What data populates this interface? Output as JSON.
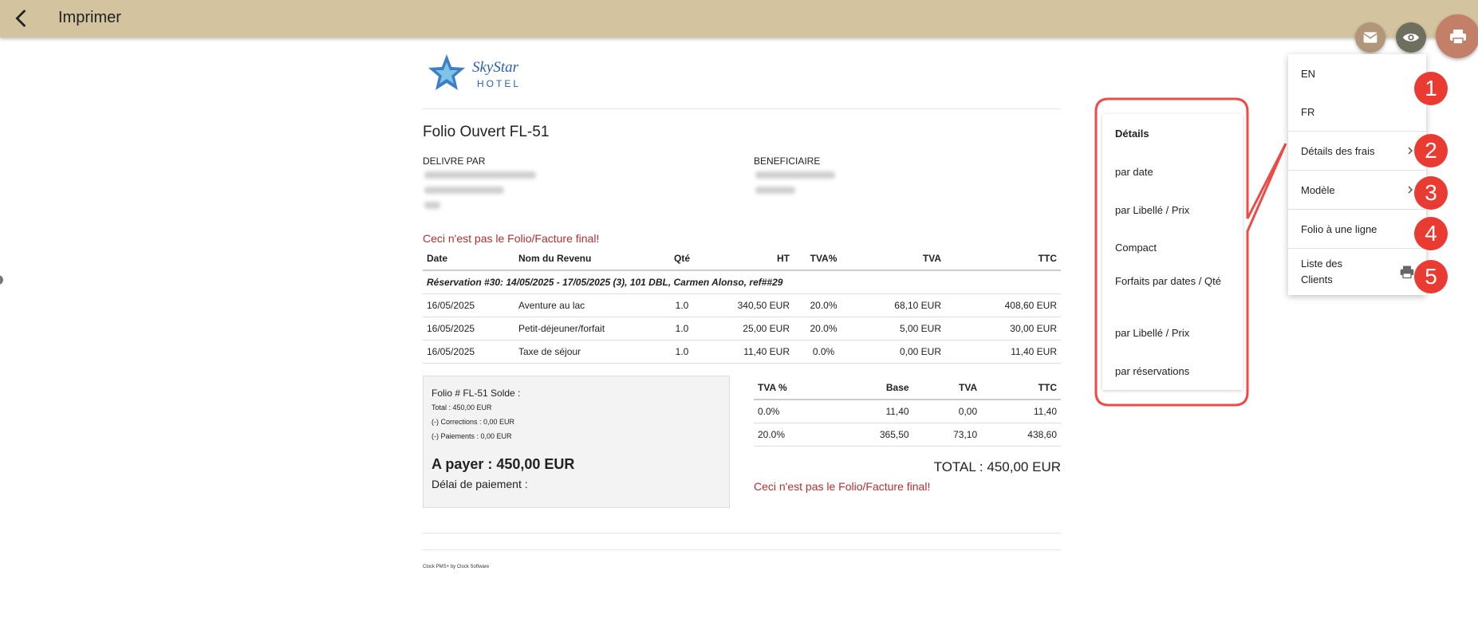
{
  "appbar": {
    "title": "Imprimer"
  },
  "fabs": {
    "mail": "mail-icon",
    "view": "eye-icon",
    "print": "print-icon"
  },
  "document": {
    "logo_brand": "SkyStar",
    "logo_sub": "HOTEL",
    "folio_title": "Folio Ouvert FL-51",
    "issuer_label": "DELIVRE PAR",
    "beneficiary_label": "BENEFICIAIRE",
    "warning": "Ceci n'est pas le Folio/Facture final!",
    "table": {
      "headers": [
        "Date",
        "Nom du Revenu",
        "Qté",
        "HT",
        "TVA%",
        "TVA",
        "TTC"
      ],
      "reservation": "Réservation #30: 14/05/2025 - 17/05/2025 (3), 101 DBL, Carmen Alonso, ref##29",
      "rows": [
        [
          "16/05/2025",
          "Aventure au lac",
          "1.0",
          "340,50 EUR",
          "20.0%",
          "68,10 EUR",
          "408,60 EUR"
        ],
        [
          "16/05/2025",
          "Petit-déjeuner/forfait",
          "1.0",
          "25,00 EUR",
          "20.0%",
          "5,00 EUR",
          "30,00 EUR"
        ],
        [
          "16/05/2025",
          "Taxe de séjour",
          "1.0",
          "11,40 EUR",
          "0.0%",
          "0,00 EUR",
          "11,40 EUR"
        ]
      ]
    },
    "solde": {
      "title": "Folio # FL-51 Solde :",
      "total": "Total : 450,00 EUR",
      "corrections": "(-) Corrections : 0,00 EUR",
      "payments": "(-) Paiements : 0,00 EUR",
      "to_pay": "A payer : 450,00 EUR",
      "delay": "Délai de paiement :"
    },
    "vat_table": {
      "headers": [
        "TVA %",
        "Base",
        "TVA",
        "TTC"
      ],
      "rows": [
        [
          "0.0%",
          "11,40",
          "0,00",
          "11,40"
        ],
        [
          "20.0%",
          "365,50",
          "73,10",
          "438,60"
        ]
      ]
    },
    "total": "TOTAL : 450,00 EUR",
    "footer": "Clock PMS+ by Clock Software"
  },
  "menu": {
    "items": [
      {
        "label": "EN"
      },
      {
        "label": "FR"
      },
      {
        "label": "Détails des frais"
      },
      {
        "label": "Modèle"
      },
      {
        "label": "Folio à une ligne"
      },
      {
        "label": "Liste des Clients"
      }
    ]
  },
  "submenu": {
    "items": [
      "Détails",
      "par date",
      "par Libellé / Prix",
      "Compact",
      "Forfaits par dates / Qté",
      "par Libellé / Prix",
      "par réservations"
    ]
  },
  "badges": [
    "1",
    "2",
    "3",
    "4",
    "5"
  ],
  "colors": {
    "appbar": "#d3c39f",
    "badge": "#ea3b33",
    "callout": "#ee4b47",
    "warning": "#b32f2f"
  }
}
